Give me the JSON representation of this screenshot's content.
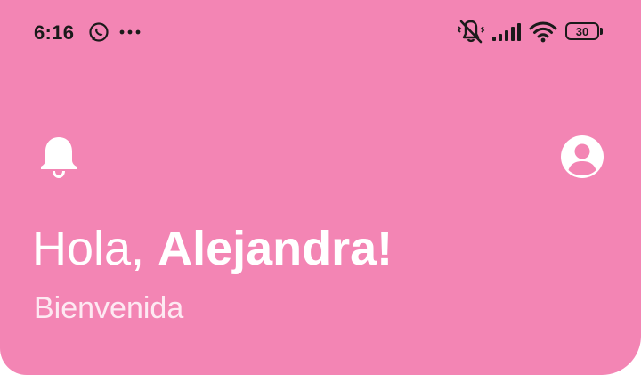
{
  "status_bar": {
    "time": "6:16",
    "battery_level": "30",
    "icons": [
      "whatsapp-icon",
      "more-dots-icon",
      "vibrate-off-icon",
      "signal-icon",
      "wifi-icon",
      "battery-icon"
    ]
  },
  "app_bar": {
    "left_icon": "bell-icon",
    "right_icon": "account-circle-icon"
  },
  "greeting": {
    "hello": "Hola, ",
    "name": "Alejandra!",
    "subtitle": "Bienvenida"
  },
  "colors": {
    "header_background": "#f385b4",
    "page_background": "#ffffff",
    "greeting_text": "#ffffff",
    "status_text": "#1a1a1a"
  }
}
